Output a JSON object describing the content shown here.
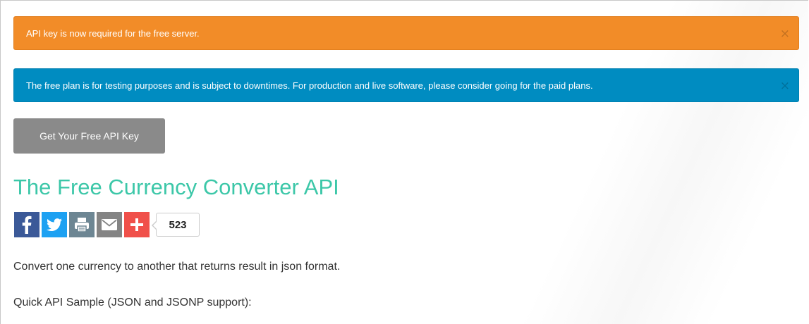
{
  "alerts": {
    "warning": {
      "text": "API key is now required for the free server.",
      "close": "×",
      "color": "#f28c28"
    },
    "info": {
      "text": "The free plan is for testing purposes and is subject to downtimes. For production and live software, please consider going for the paid plans.",
      "close": "×",
      "color": "#008cc1"
    }
  },
  "cta": {
    "label": "Get Your Free API Key"
  },
  "page": {
    "title": "The Free Currency Converter API",
    "title_color": "#3cc7a8"
  },
  "share": {
    "buttons": [
      {
        "icon": "facebook-icon",
        "color": "#3b5998"
      },
      {
        "icon": "twitter-icon",
        "color": "#1da1f2"
      },
      {
        "icon": "print-icon",
        "color": "#6d8693"
      },
      {
        "icon": "email-icon",
        "color": "#848484"
      },
      {
        "icon": "plus-icon",
        "color": "#f0504a"
      }
    ],
    "count": "523"
  },
  "content": {
    "description": "Convert one currency to another that returns result in json format.",
    "sample_heading": "Quick API Sample (JSON and JSONP support):"
  }
}
